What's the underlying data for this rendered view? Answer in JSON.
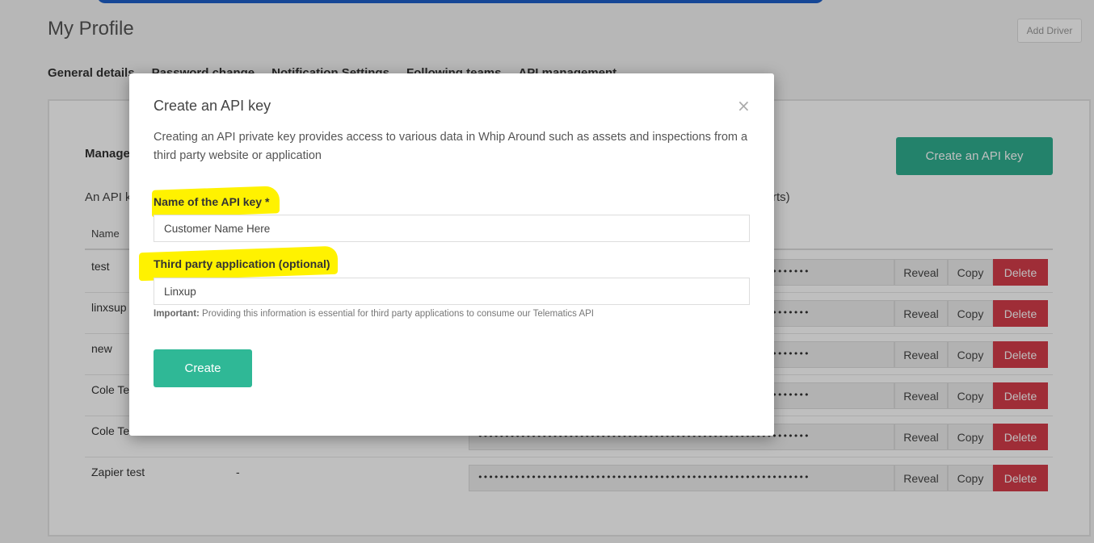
{
  "page": {
    "title": "My Profile",
    "add_driver_label": "Add Driver"
  },
  "tabs": [
    {
      "label": "General details"
    },
    {
      "label": "Password change"
    },
    {
      "label": "Notification Settings"
    },
    {
      "label": "Following teams"
    },
    {
      "label": "API management"
    }
  ],
  "card": {
    "heading": "Manage",
    "description_visible": "An API k",
    "description_tail": "rts)",
    "create_button_label": "Create an API key",
    "column_name_header": "Name"
  },
  "api_keys": [
    {
      "name": "test",
      "app": "",
      "key_mask": "••••••••••••••••••••••••••••••••••••••••••••••••••••••••••••••",
      "reveal": "Reveal",
      "copy": "Copy",
      "delete": "Delete"
    },
    {
      "name": "linxsup",
      "app": "",
      "key_mask": "••••••••••••••••••••••••••••••••••••••••••••••••••••••••••••••",
      "reveal": "Reveal",
      "copy": "Copy",
      "delete": "Delete"
    },
    {
      "name": "new",
      "app": "",
      "key_mask": "••••••••••••••••••••••••••••••••••••••••••••••••••••••••••••••",
      "reveal": "Reveal",
      "copy": "Copy",
      "delete": "Delete"
    },
    {
      "name": "Cole Te",
      "app": "",
      "key_mask": "••••••••••••••••••••••••••••••••••••••••••••••••••••••••••••••",
      "reveal": "Reveal",
      "copy": "Copy",
      "delete": "Delete"
    },
    {
      "name": "Cole Te",
      "app": "",
      "key_mask": "••••••••••••••••••••••••••••••••••••••••••••••••••••••••••••••",
      "reveal": "Reveal",
      "copy": "Copy",
      "delete": "Delete"
    },
    {
      "name": "Zapier test",
      "app": "-",
      "key_mask": "••••••••••••••••••••••••••••••••••••••••••••••••••••••••••••••",
      "reveal": "Reveal",
      "copy": "Copy",
      "delete": "Delete"
    }
  ],
  "modal": {
    "title": "Create an API key",
    "close_symbol": "×",
    "description": "Creating an API private key provides access to various data in Whip Around such as assets and inspections from a third party website or application",
    "name_label": "Name of the API key *",
    "name_value": "Customer Name Here",
    "app_label": "Third party application (optional)",
    "app_value": "Linxup",
    "help_strong": "Important:",
    "help_text": " Providing this information is essential for third party applications to consume our Telematics API",
    "create_label": "Create"
  },
  "colors": {
    "primary_green": "#2fb896",
    "danger_red": "#d43c4a",
    "highlight_yellow": "#fff200",
    "top_accent_blue": "#1e5fc9"
  }
}
